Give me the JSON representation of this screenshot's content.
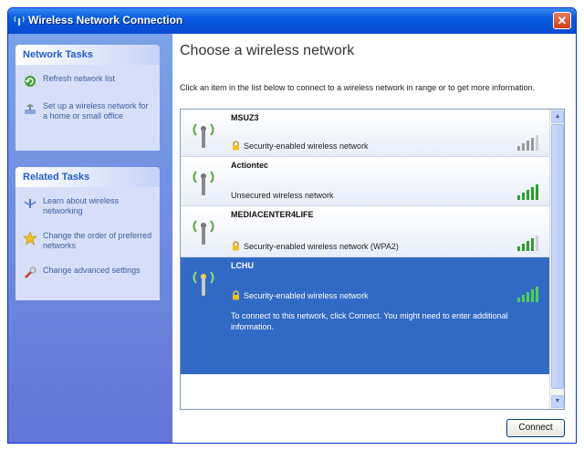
{
  "window": {
    "title": "Wireless Network Connection",
    "close_glyph": "✕"
  },
  "sidebar": {
    "network_tasks": {
      "header": "Network Tasks",
      "items": [
        {
          "label": "Refresh network list",
          "icon": "refresh-icon"
        },
        {
          "label": "Set up a wireless network for a home or small office",
          "icon": "setup-wireless-icon"
        }
      ]
    },
    "related_tasks": {
      "header": "Related Tasks",
      "items": [
        {
          "label": "Learn about wireless networking",
          "icon": "info-icon"
        },
        {
          "label": "Change the order of preferred networks",
          "icon": "star-icon"
        },
        {
          "label": "Change advanced settings",
          "icon": "settings-icon"
        }
      ]
    }
  },
  "main": {
    "title": "Choose a wireless network",
    "description": "Click an item in the list below to connect to a wireless network in range or to get more information.",
    "networks": [
      {
        "name": "MSUZ3",
        "security": "Security-enabled wireless network",
        "secured": true,
        "selected": false,
        "signal": 4
      },
      {
        "name": "Actiontec",
        "security": "Unsecured wireless network",
        "secured": false,
        "selected": false,
        "signal": 5
      },
      {
        "name": "MEDIACENTER4LIFE",
        "security": "Security-enabled wireless network (WPA2)",
        "secured": true,
        "selected": false,
        "signal": 4
      },
      {
        "name": "LCHU",
        "security": "Security-enabled wireless network",
        "secured": true,
        "selected": true,
        "signal": 5,
        "info": "To connect to this network, click Connect. You might need to enter additional information."
      }
    ],
    "connect_label": "Connect"
  },
  "colors": {
    "titlebar": "#0553d8",
    "selected": "#316ac5",
    "sidebar": "#6375d6"
  }
}
